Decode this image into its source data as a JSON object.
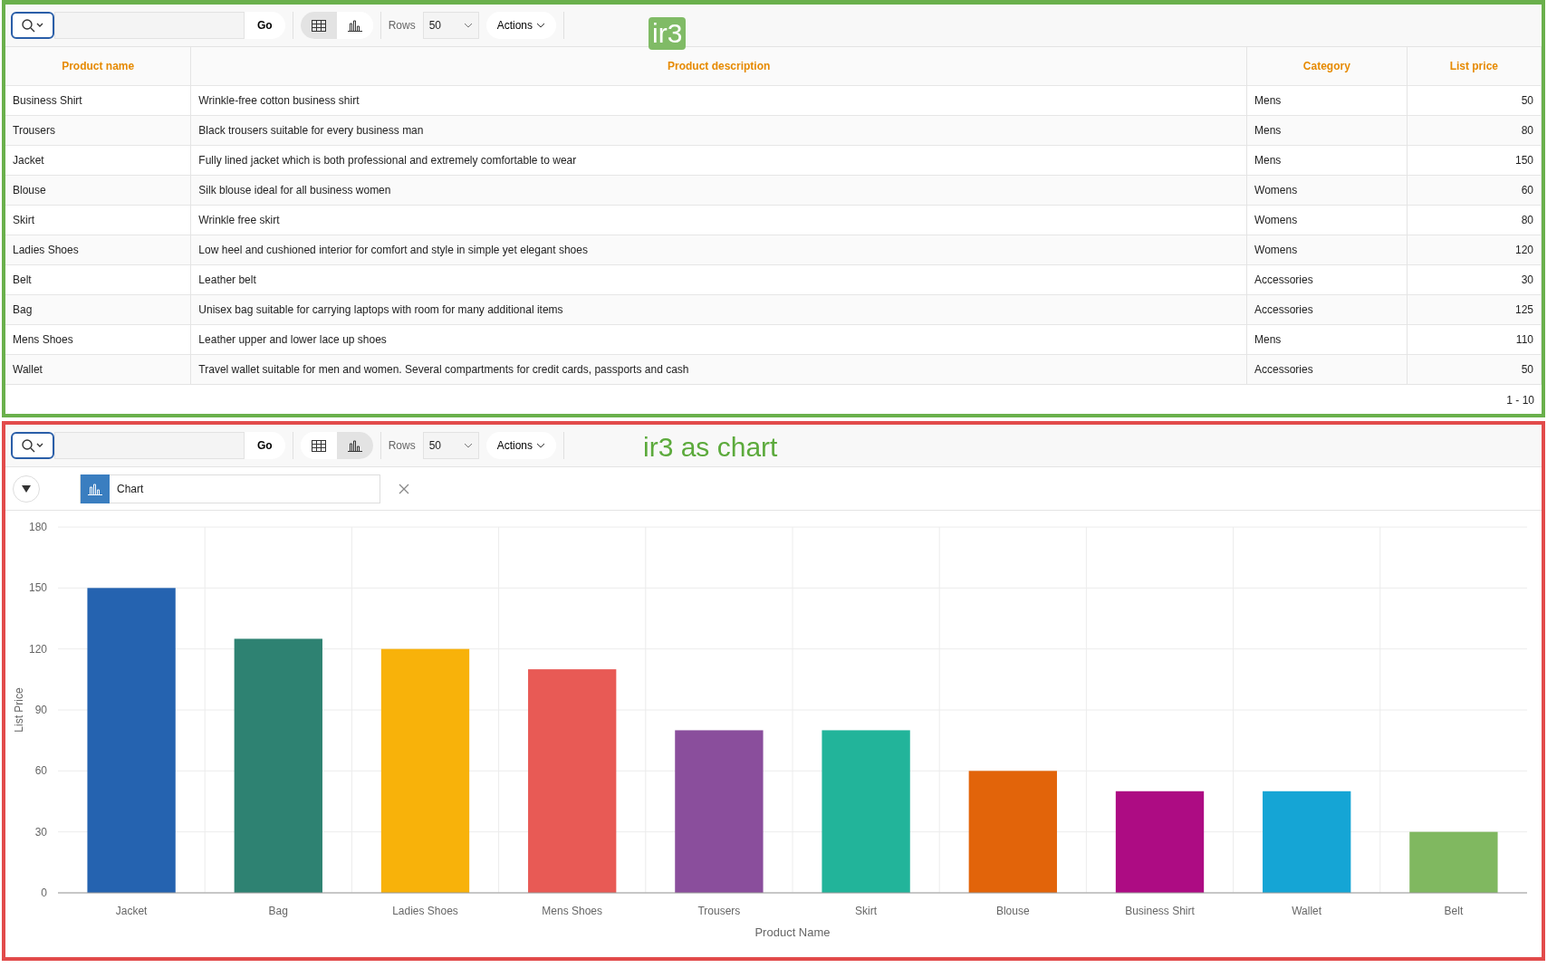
{
  "report": {
    "toolbar": {
      "go": "Go",
      "views": [
        {
          "kind": "grid",
          "selected": true
        },
        {
          "kind": "chart",
          "selected": false
        }
      ],
      "rows_label": "Rows",
      "rows_value": "50",
      "actions": "Actions"
    },
    "annotation": "ir3",
    "table": {
      "columns": [
        "Product name",
        "Product description",
        "Category",
        "List price"
      ],
      "rows": [
        [
          "Business Shirt",
          "Wrinkle-free cotton business shirt",
          "Mens",
          "50"
        ],
        [
          "Trousers",
          "Black trousers suitable for every business man",
          "Mens",
          "80"
        ],
        [
          "Jacket",
          "Fully lined jacket which is both professional and extremely comfortable to wear",
          "Mens",
          "150"
        ],
        [
          "Blouse",
          "Silk blouse ideal for all business women",
          "Womens",
          "60"
        ],
        [
          "Skirt",
          "Wrinkle free skirt",
          "Womens",
          "80"
        ],
        [
          "Ladies Shoes",
          "Low heel and cushioned interior for comfort and style in simple yet elegant shoes",
          "Womens",
          "120"
        ],
        [
          "Belt",
          "Leather belt",
          "Accessories",
          "30"
        ],
        [
          "Bag",
          "Unisex bag suitable for carrying laptops with room for many additional items",
          "Accessories",
          "125"
        ],
        [
          "Mens Shoes",
          "Leather upper and lower lace up shoes",
          "Mens",
          "110"
        ],
        [
          "Wallet",
          "Travel wallet suitable for men and women. Several compartments for credit cards, passports and cash",
          "Accessories",
          "50"
        ]
      ],
      "pagination": "1 - 10"
    }
  },
  "chart_report": {
    "toolbar": {
      "go": "Go",
      "views": [
        {
          "kind": "grid",
          "selected": false
        },
        {
          "kind": "chart",
          "selected": true
        }
      ],
      "rows_label": "Rows",
      "rows_value": "50",
      "actions": "Actions"
    },
    "annotation": "ir3 as chart",
    "filter": {
      "label": "Chart"
    },
    "chart_data": {
      "type": "bar",
      "xlabel": "Product Name",
      "ylabel": "List Price",
      "categories": [
        "Jacket",
        "Bag",
        "Ladies Shoes",
        "Mens Shoes",
        "Trousers",
        "Skirt",
        "Blouse",
        "Business Shirt",
        "Wallet",
        "Belt"
      ],
      "values": [
        150,
        125,
        120,
        110,
        80,
        80,
        60,
        50,
        50,
        30
      ],
      "grid": true,
      "colors": [
        "#2563b0",
        "#2e8272",
        "#f8b20a",
        "#e85a55",
        "#8a4e9c",
        "#22b49a",
        "#e2640a",
        "#ad0c83",
        "#15a5d5",
        "#80b860"
      ],
      "ylim": [
        0,
        180
      ],
      "yticks": [
        0,
        30,
        60,
        90,
        120,
        150,
        180
      ]
    }
  }
}
